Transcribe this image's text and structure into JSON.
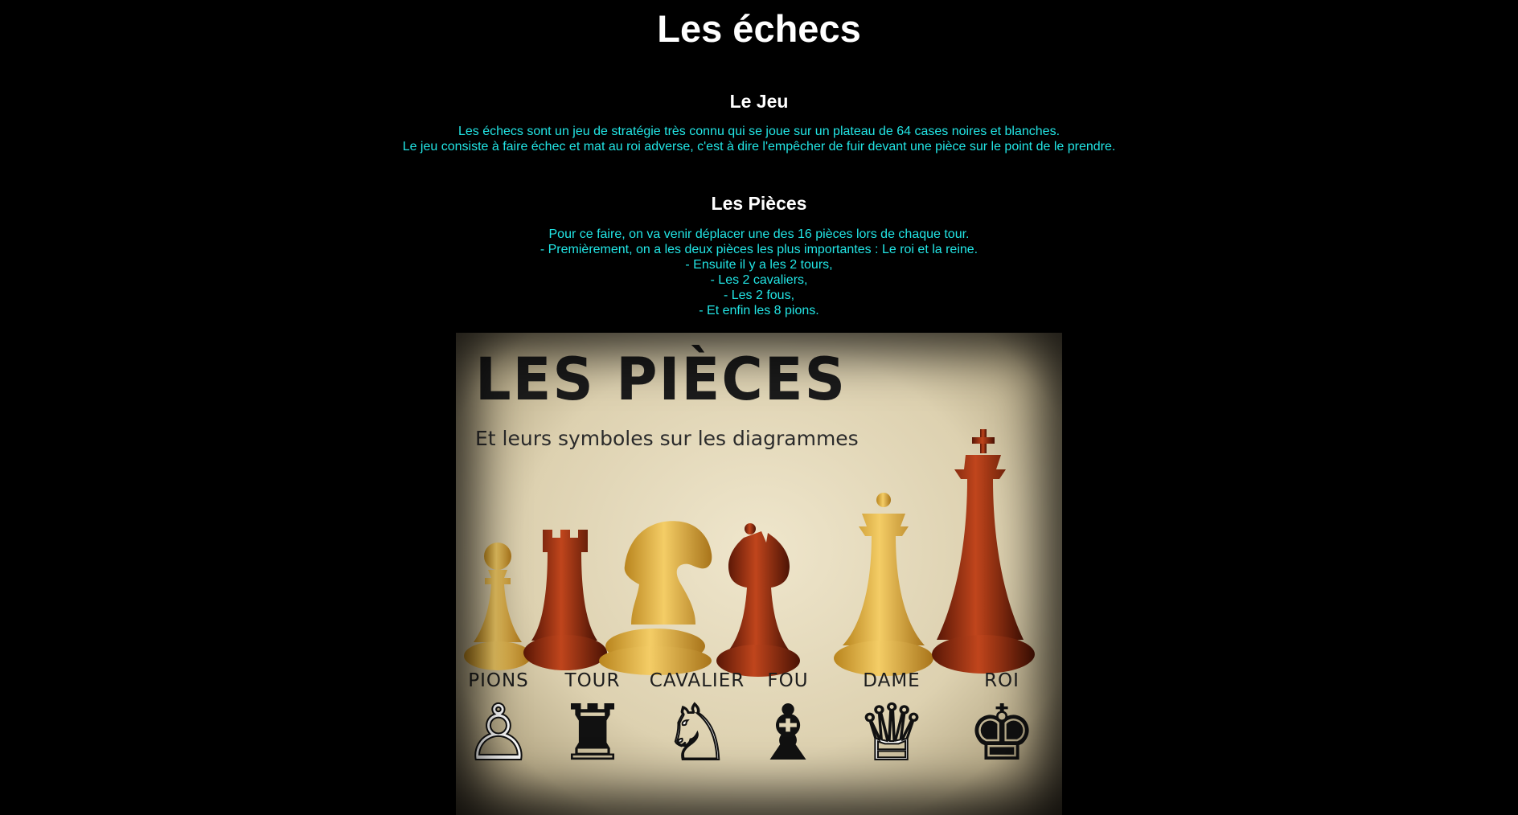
{
  "page": {
    "title": "Les échecs"
  },
  "jeu": {
    "heading": "Le Jeu",
    "lines": [
      "Les échecs sont un jeu de stratégie très connu qui se joue sur un plateau de 64 cases noires et blanches.",
      "Le jeu consiste à faire échec et mat au roi adverse, c'est à dire l'empêcher de fuir devant une pièce sur le point de le prendre."
    ]
  },
  "pieces": {
    "heading": "Les Pièces",
    "lines": [
      "Pour ce faire, on va venir déplacer une des 16 pièces lors de chaque tour.",
      "- Premièrement, on a les deux pièces les plus importantes : Le roi et la reine.",
      "- Ensuite il y a les 2 tours,",
      "- Les 2 cavaliers,",
      "- Les 2 fous,",
      "- Et enfin les 8 pions."
    ]
  },
  "poster": {
    "title": "LES PIÈCES",
    "subtitle": "Et leurs symboles sur les diagrammes",
    "labels": [
      "PIONS",
      "TOUR",
      "CAVALIER",
      "FOU",
      "DAME",
      "ROI"
    ],
    "symbols": [
      {
        "icon": "pawn-icon",
        "glyph": "♙",
        "color": "white"
      },
      {
        "icon": "rook-icon",
        "glyph": "♜",
        "color": "black"
      },
      {
        "icon": "knight-icon",
        "glyph": "♘",
        "color": "white"
      },
      {
        "icon": "bishop-icon",
        "glyph": "♝",
        "color": "black"
      },
      {
        "icon": "queen-icon",
        "glyph": "♕",
        "color": "white"
      },
      {
        "icon": "king-icon",
        "glyph": "♚",
        "color": "black"
      }
    ],
    "colors": {
      "light_wood": "#e8b84a",
      "dark_wood": "#9a2c10"
    }
  },
  "colors": {
    "background": "#000000",
    "heading": "#ffffff",
    "text": "#22e5e5"
  }
}
